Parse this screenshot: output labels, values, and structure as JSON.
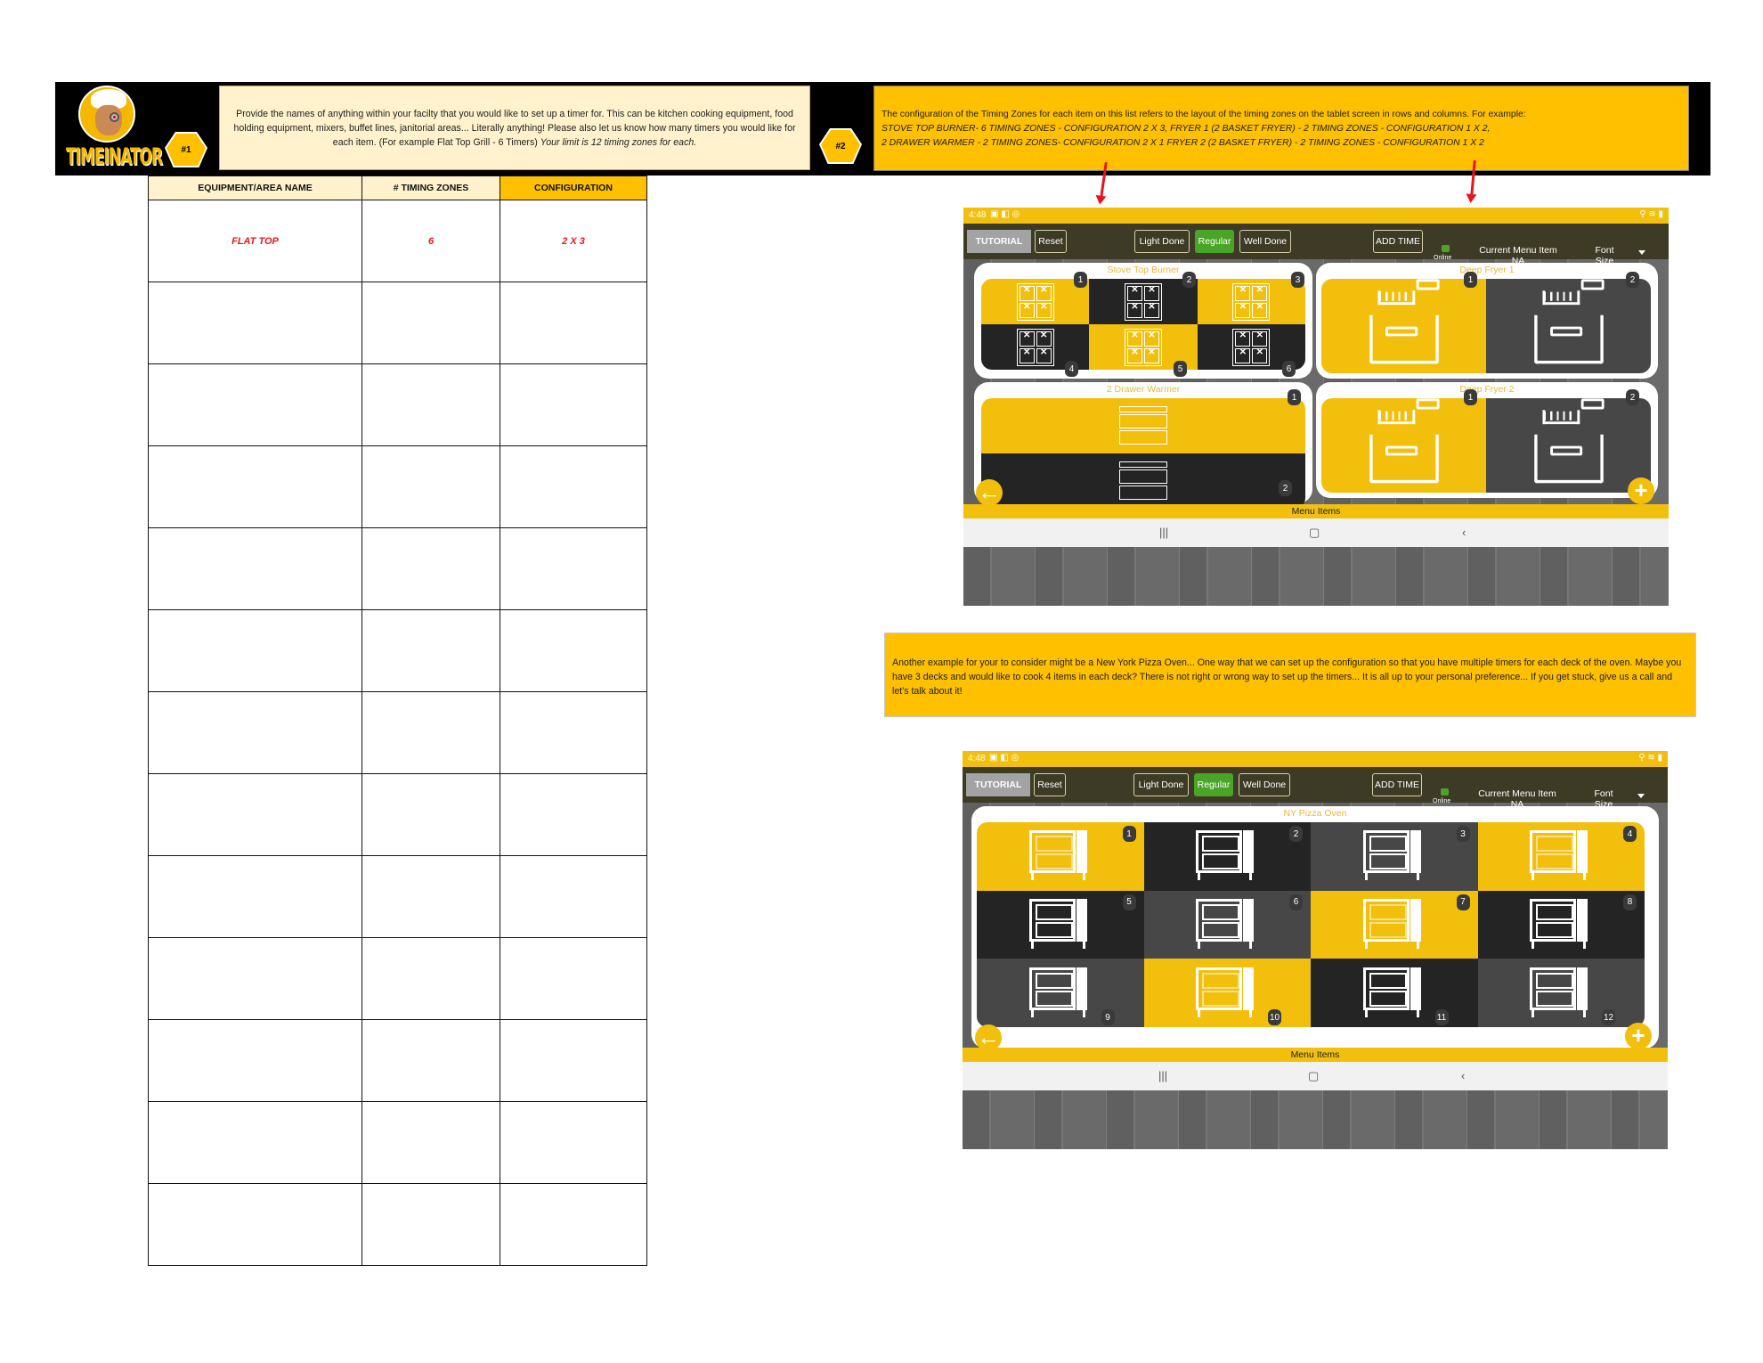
{
  "brand": {
    "logo_text": "TIMEINATOR"
  },
  "step1": {
    "badge": "#1",
    "text": "Provide the names of anything within your facilty that you  would like to set up a timer for. This can be kitchen cooking equipment, food holding equipment, mixers, buffet lines, janitorial areas... Literally anything! Please also let us know how many timers you would like for each item. (For example Flat Top Grill - 6 Timers)",
    "text_italic": "Your limit is 12 timing zones for each."
  },
  "step2": {
    "badge": "#2",
    "intro": "The configuration of the Timing Zones for each item on this list refers to the layout of the timing zones on the tablet screen in rows and columns. For example:",
    "example_line1": "STOVE TOP BURNER- 6 TIMING ZONES - CONFIGURATION 2 X 3,    FRYER 1 (2 BASKET FRYER) - 2 TIMING ZONES - CONFIGURATION 1 X 2,",
    "example_line2": "2 DRAWER WARMER - 2 TIMING ZONES- CONFIGURATION 2 X 1    FRYER 2 (2 BASKET FRYER) - 2 TIMING ZONES - CONFIGURATION 1 X 2"
  },
  "table": {
    "headers": [
      "EQUIPMENT/AREA NAME",
      "# TIMING ZONES",
      "CONFIGURATION"
    ],
    "rows": [
      [
        "FLAT TOP",
        "6",
        "2 X 3"
      ],
      [
        "",
        "",
        ""
      ],
      [
        "",
        "",
        ""
      ],
      [
        "",
        "",
        ""
      ],
      [
        "",
        "",
        ""
      ],
      [
        "",
        "",
        ""
      ],
      [
        "",
        "",
        ""
      ],
      [
        "",
        "",
        ""
      ],
      [
        "",
        "",
        ""
      ],
      [
        "",
        "",
        ""
      ],
      [
        "",
        "",
        ""
      ],
      [
        "",
        "",
        ""
      ],
      [
        "",
        "",
        ""
      ]
    ]
  },
  "note3": {
    "text": "Another example for your to consider might be a New York Pizza Oven...  One way that we can set up the configuration so that you have multiple timers for each deck of the oven.  Maybe you have 3 decks and would like to cook 4 items in each deck?  There is not right or wrong way to set up the timers... It is all up to your personal preference... If you get stuck, give us a call and let's talk about it!"
  },
  "tablet_common": {
    "time": "4:48",
    "status_icons": "▣ ◧ ◎",
    "right_icons": "⚲ ≋ ▮",
    "tutorial": "TUTORIAL",
    "reset": "Reset",
    "light_done": "Light Done",
    "regular": "Regular",
    "well_done": "Well Done",
    "add_time": "ADD TIME",
    "online": "Online",
    "current_menu_item_label": "Current Menu Item",
    "current_menu_item_value": "NA",
    "font_size_line1": "Font",
    "font_size_line2": "Size",
    "menu_items": "Menu Items",
    "nav_recent": "|||",
    "nav_home": "▢",
    "nav_back": "‹",
    "back_fab": "←",
    "add_fab": "+"
  },
  "tablet1": {
    "cards": [
      {
        "title": "Stove Top Burner",
        "config": "2x3",
        "zones": [
          "1",
          "2",
          "3",
          "4",
          "5",
          "6"
        ],
        "colors": [
          "yellow",
          "black",
          "yellow",
          "black",
          "yellow",
          "black"
        ]
      },
      {
        "title": "Deep Fryer 1",
        "config": "1x2",
        "zones": [
          "1",
          "2"
        ],
        "colors": [
          "yellow",
          "gray"
        ]
      },
      {
        "title": "2 Drawer Warmer",
        "config": "2x1",
        "zones": [
          "1",
          "2"
        ],
        "colors": [
          "yellow",
          "black"
        ]
      },
      {
        "title": "Deep Fryer 2",
        "config": "1x2",
        "zones": [
          "1",
          "2"
        ],
        "colors": [
          "yellow",
          "gray"
        ]
      }
    ]
  },
  "tablet2": {
    "cards": [
      {
        "title": "NY Pizza Oven",
        "config": "3x4",
        "zones": [
          "1",
          "2",
          "3",
          "4",
          "5",
          "6",
          "7",
          "8",
          "9",
          "10",
          "11",
          "12"
        ],
        "colors": [
          "yellow",
          "black",
          "gray",
          "yellow",
          "black",
          "gray",
          "yellow",
          "black",
          "gray",
          "yellow",
          "black",
          "gray"
        ]
      }
    ]
  },
  "colors": {
    "accent_yellow": "#ffc000",
    "tablet_yellow": "#f2c00c",
    "note_cream": "#fff2cc",
    "red": "#e8141c",
    "green": "#4aa526"
  }
}
